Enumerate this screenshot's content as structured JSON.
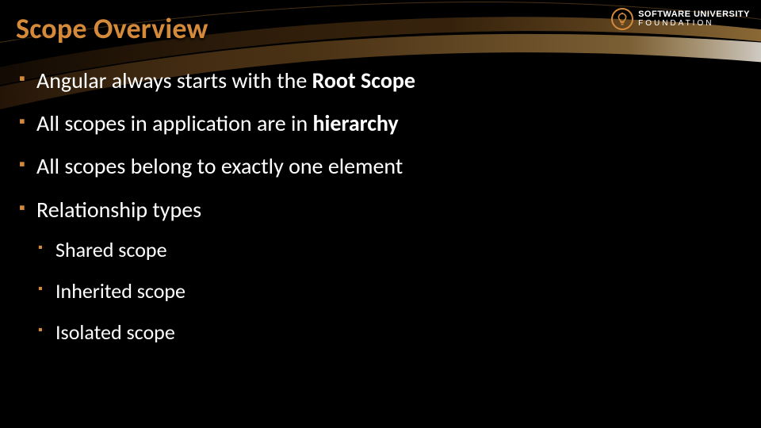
{
  "title": "Scope Overview",
  "bullets": {
    "b0": {
      "pre": "Angular always starts with the ",
      "bold": "Root Scope"
    },
    "b1": {
      "pre": "All scopes in application are in ",
      "bold": "hierarchy"
    },
    "b2": {
      "text": "All scopes belong to exactly one element"
    },
    "b3": {
      "text": "Relationship types"
    }
  },
  "sub": {
    "s0": "Shared scope",
    "s1": "Inherited scope",
    "s2": "Isolated scope"
  },
  "logo": {
    "line1": "SOFTWARE UNIVERSITY",
    "line2": "FOUNDATION"
  }
}
